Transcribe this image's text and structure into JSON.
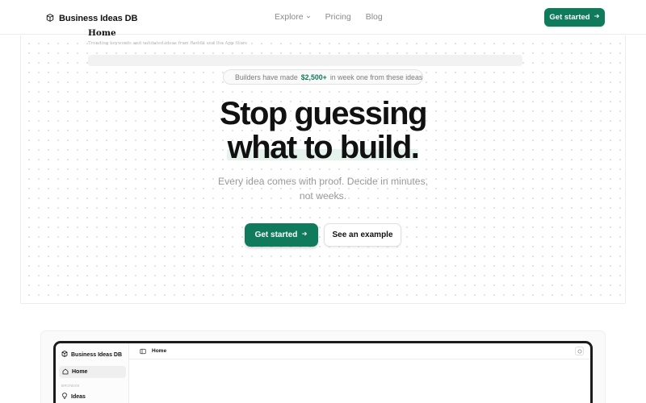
{
  "colors": {
    "accent": "#0f7a5c",
    "badge_dot": "#1aa277",
    "highlight": "#e6f3ec"
  },
  "header": {
    "brand": "Business Ideas DB",
    "brand_icon": "cube-icon",
    "nav": [
      {
        "label": "Explore",
        "has_dropdown": true
      },
      {
        "label": "Pricing"
      },
      {
        "label": "Blog"
      }
    ],
    "cta": "Get started"
  },
  "hero": {
    "badge": {
      "prefix": "Builders have made",
      "amount": "$2,500+",
      "suffix": "in week one from these ideas"
    },
    "title_line1": "Stop guessing",
    "title_line2": "what to build.",
    "subtitle": "Every idea comes with proof. Decide in minutes, not weeks.",
    "primary_button": "Get started",
    "secondary_button": "See an example"
  },
  "preview": {
    "sidebar": {
      "brand": "Business Ideas DB",
      "active_item": "Home",
      "section_label": "BROWSE",
      "items": [
        "Ideas"
      ]
    },
    "topbar": {
      "breadcrumb": "Home"
    },
    "main": {
      "title": "Home",
      "subtitle": "Trending keywords and validated ideas from Reddit and the App Store"
    }
  }
}
